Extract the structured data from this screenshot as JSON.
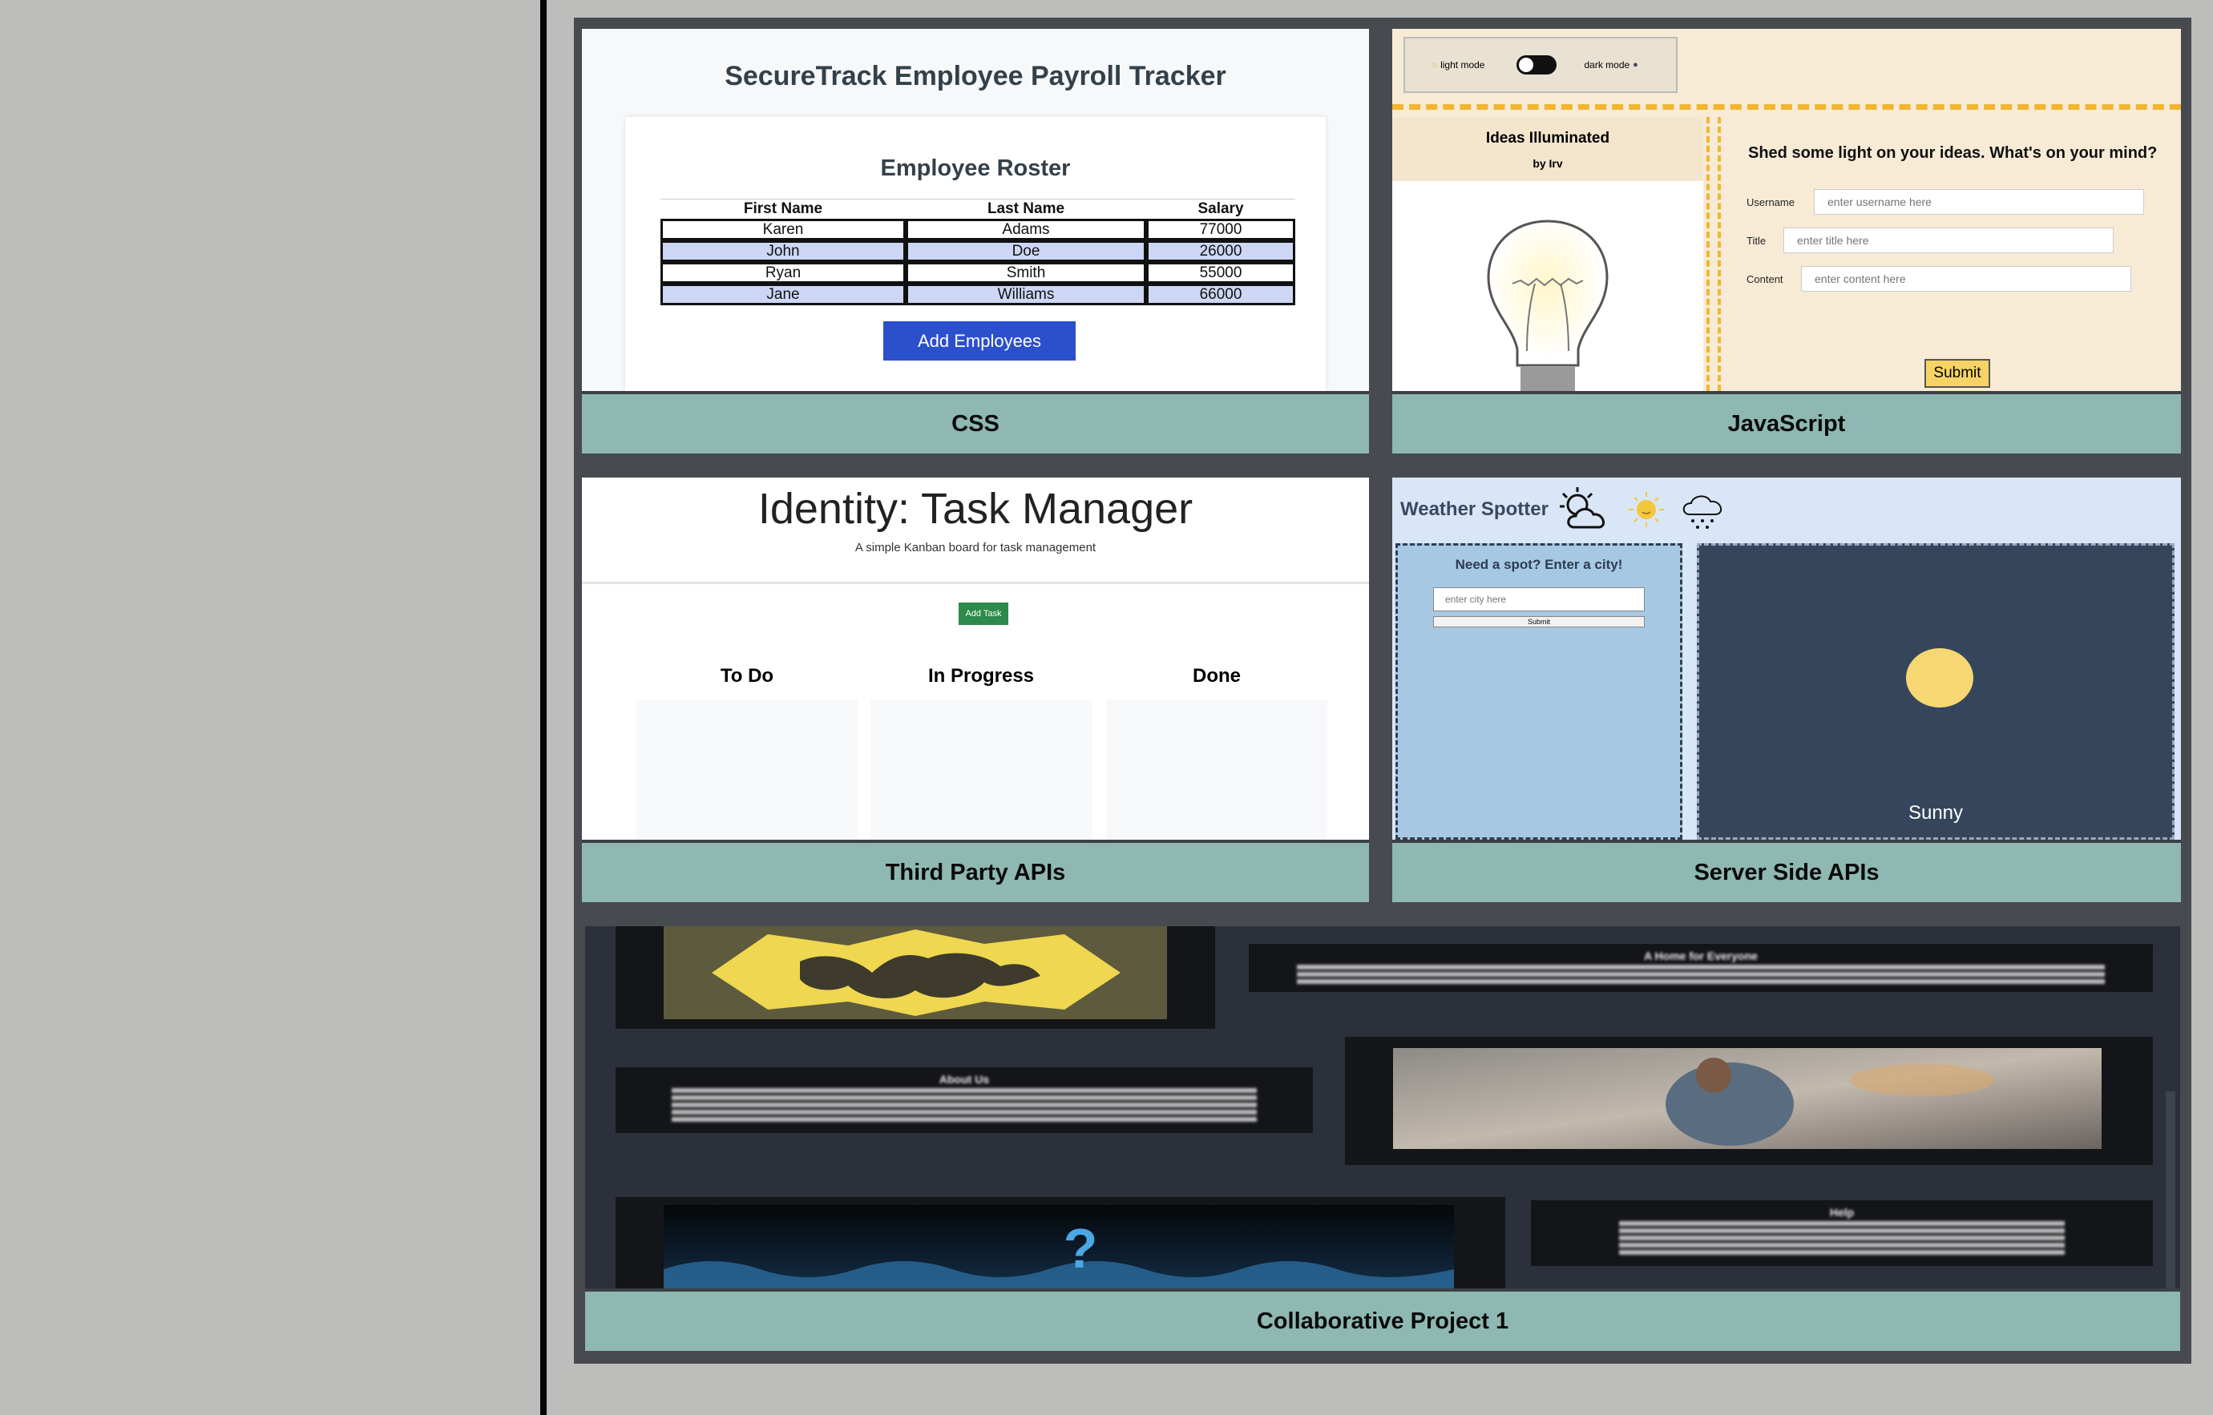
{
  "cards": [
    {
      "label": "CSS"
    },
    {
      "label": "JavaScript"
    },
    {
      "label": "Third Party APIs"
    },
    {
      "label": "Server Side APIs"
    },
    {
      "label": "Collaborative Project 1"
    }
  ],
  "css_preview": {
    "title": "SecureTrack Employee Payroll Tracker",
    "roster_title": "Employee Roster",
    "headers": [
      "First Name",
      "Last Name",
      "Salary"
    ],
    "rows": [
      [
        "Karen",
        "Adams",
        "77000"
      ],
      [
        "John",
        "Doe",
        "26000"
      ],
      [
        "Ryan",
        "Smith",
        "55000"
      ],
      [
        "Jane",
        "Williams",
        "66000"
      ]
    ],
    "button": "Add Employees"
  },
  "js_preview": {
    "light_mode": "light mode",
    "dark_mode": "dark mode",
    "brand": "Ideas Illuminated",
    "byline": "by Irv",
    "prompt": "Shed some light on your ideas. What's on your mind?",
    "username_label": "Username",
    "username_placeholder": "enter username here",
    "title_label": "Title",
    "title_placeholder": "enter title here",
    "content_label": "Content",
    "content_placeholder": "enter content here",
    "submit": "Submit"
  },
  "third_party_preview": {
    "title": "Identity: Task Manager",
    "subtitle": "A simple Kanban board for task management",
    "add_task": "Add Task",
    "columns": [
      "To Do",
      "In Progress",
      "Done"
    ]
  },
  "server_side_preview": {
    "title": "Weather Spotter",
    "prompt": "Need a spot? Enter a city!",
    "city_placeholder": "enter city here",
    "submit": "Submit",
    "condition": "Sunny"
  },
  "collab_preview": {
    "heading_1": "A Home for Everyone",
    "heading_2": "About Us",
    "heading_3": "Help"
  }
}
